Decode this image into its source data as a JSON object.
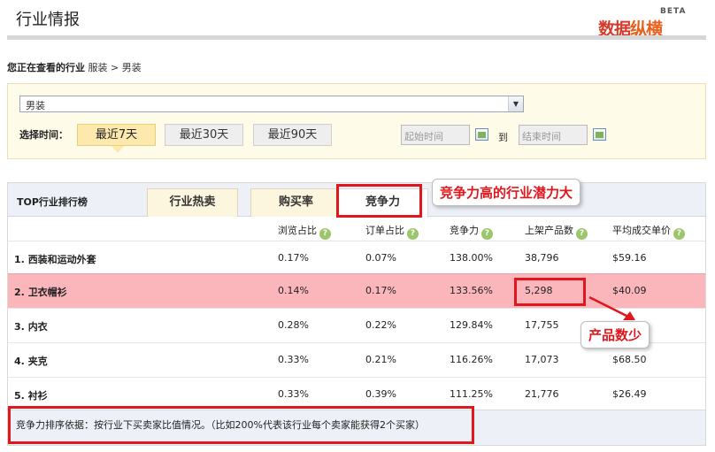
{
  "header": {
    "title": "行业情报",
    "logo_part1": "数据",
    "logo_part2": "纵横",
    "logo_badge": "BETA"
  },
  "breadcrumb": {
    "lead": "您正在查看的行业",
    "path": "服装 > 男装"
  },
  "filter": {
    "category_value": "男装",
    "time_label": "选择时间：",
    "time_buttons": [
      "最近7天",
      "最近30天",
      "最近90天"
    ],
    "active_time": "最近7天",
    "start_placeholder": "起始时间",
    "to_label": "到",
    "end_placeholder": "结束时间"
  },
  "ranking": {
    "title": "TOP行业排行榜",
    "tabs": [
      "行业热卖",
      "购买率",
      "竞争力"
    ],
    "active_tab": "竞争力",
    "columns": [
      "浏览占比",
      "订单占比",
      "竞争力",
      "上架产品数",
      "平均成交单价"
    ],
    "rows": [
      {
        "rank": "1.",
        "name": "西装和运动外套",
        "browse": "0.17%",
        "order": "0.07%",
        "competitiveness": "138.00%",
        "listed": "38,796",
        "avg_price": "$59.16"
      },
      {
        "rank": "2.",
        "name": "卫衣帽衫",
        "browse": "0.14%",
        "order": "0.17%",
        "competitiveness": "133.56%",
        "listed": "5,298",
        "avg_price": "$40.09"
      },
      {
        "rank": "3.",
        "name": "内衣",
        "browse": "0.28%",
        "order": "0.22%",
        "competitiveness": "129.84%",
        "listed": "17,755",
        "avg_price": ""
      },
      {
        "rank": "4.",
        "name": "夹克",
        "browse": "0.33%",
        "order": "0.21%",
        "competitiveness": "116.26%",
        "listed": "17,073",
        "avg_price": "$68.50"
      },
      {
        "rank": "5.",
        "name": "衬衫",
        "browse": "0.33%",
        "order": "0.39%",
        "competitiveness": "111.25%",
        "listed": "21,776",
        "avg_price": "$26.49"
      }
    ],
    "note": "竞争力排序依据：按行业下买卖家比值情况。（比如200%代表该行业每个卖家能获得2个买家）"
  },
  "annotations": {
    "callout_tab": "竞争力高的行业潜力大",
    "callout_product": "产品数少",
    "color": "#e0171d"
  }
}
